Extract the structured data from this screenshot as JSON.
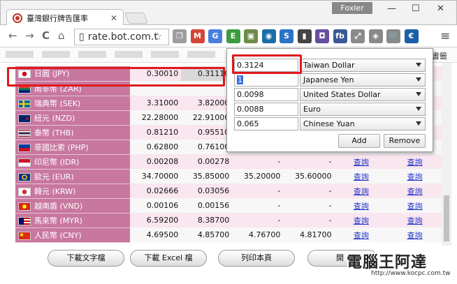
{
  "window": {
    "tab_title": "臺灣銀行牌告匯率",
    "tab_close": "✕",
    "user_label": "Foxler",
    "minimize": "—",
    "maximize": "☐",
    "close": "✕"
  },
  "toolbar": {
    "back": "←",
    "forward": "→",
    "reload": "C",
    "home": "⌂",
    "url": "rate.bot.com.t",
    "star": "☆",
    "menu": "≡",
    "extensions": [
      {
        "name": "copy-extension",
        "label": "❐",
        "color": "#9e9e9e"
      },
      {
        "name": "gmail-extension",
        "label": "M",
        "color": "#d44638"
      },
      {
        "name": "translate-extension",
        "label": "G",
        "color": "#4a7fe0"
      },
      {
        "name": "evernote-extension",
        "label": "E",
        "color": "#3e9c3e"
      },
      {
        "name": "image-extension",
        "label": "▣",
        "color": "#6e8a4a"
      },
      {
        "name": "vpn-extension",
        "label": "◉",
        "color": "#1a6ea8"
      },
      {
        "name": "s-extension",
        "label": "S",
        "color": "#2a73c7"
      },
      {
        "name": "bookmark-extension",
        "label": "▮",
        "color": "#444444"
      },
      {
        "name": "screenshot-extension",
        "label": "◘",
        "color": "#6a4e9e"
      },
      {
        "name": "facebook-extension",
        "label": "fb",
        "color": "#3b5998"
      },
      {
        "name": "share-extension",
        "label": "⤢",
        "color": "#8a8a8a"
      },
      {
        "name": "tag-extension",
        "label": "◈",
        "color": "#8a8a8a"
      },
      {
        "name": "cart-extension",
        "label": "🛒",
        "color": "#8a8a8a"
      },
      {
        "name": "currency-extension",
        "label": "€",
        "color": "#1a5fa8"
      }
    ]
  },
  "bookmarks": {
    "right_label": "書籤"
  },
  "rates": [
    {
      "flag": "jp",
      "currency": "日圓 (JPY)",
      "buy": "0.30010",
      "sell": "0.31110",
      "spot_buy": "",
      "spot_sell": "",
      "q1": "",
      "q2": ""
    },
    {
      "flag": "za",
      "currency": "南非幣 (ZAR)",
      "buy": "",
      "sell": "",
      "spot_buy": "",
      "spot_sell": "",
      "q1": "",
      "q2": ""
    },
    {
      "flag": "se",
      "currency": "瑞典幣 (SEK)",
      "buy": "3.31000",
      "sell": "3.82000",
      "spot_buy": "",
      "spot_sell": "",
      "q1": "",
      "q2": ""
    },
    {
      "flag": "nz",
      "currency": "紐元 (NZD)",
      "buy": "22.28000",
      "sell": "22.91000",
      "spot_buy": "",
      "spot_sell": "",
      "q1": "",
      "q2": ""
    },
    {
      "flag": "th",
      "currency": "泰幣 (THB)",
      "buy": "0.81210",
      "sell": "0.95510",
      "spot_buy": "",
      "spot_sell": "",
      "q1": "",
      "q2": ""
    },
    {
      "flag": "ph",
      "currency": "菲國比索 (PHP)",
      "buy": "0.62800",
      "sell": "0.76100",
      "spot_buy": "",
      "spot_sell": "",
      "q1": "",
      "q2": ""
    },
    {
      "flag": "id",
      "currency": "印尼幣 (IDR)",
      "buy": "0.00208",
      "sell": "0.00278",
      "spot_buy": "-",
      "spot_sell": "-",
      "q1": "查詢",
      "q2": "查詢"
    },
    {
      "flag": "eu",
      "currency": "歐元 (EUR)",
      "buy": "34.70000",
      "sell": "35.85000",
      "spot_buy": "35.20000",
      "spot_sell": "35.60000",
      "q1": "查詢",
      "q2": "查詢"
    },
    {
      "flag": "kr",
      "currency": "韓元 (KRW)",
      "buy": "0.02666",
      "sell": "0.03056",
      "spot_buy": "-",
      "spot_sell": "-",
      "q1": "查詢",
      "q2": "查詢"
    },
    {
      "flag": "vn",
      "currency": "越南盾 (VND)",
      "buy": "0.00106",
      "sell": "0.00156",
      "spot_buy": "-",
      "spot_sell": "-",
      "q1": "查詢",
      "q2": "查詢"
    },
    {
      "flag": "my",
      "currency": "馬來幣 (MYR)",
      "buy": "6.59200",
      "sell": "8.38700",
      "spot_buy": "-",
      "spot_sell": "-",
      "q1": "查詢",
      "q2": "查詢"
    },
    {
      "flag": "cn",
      "currency": "人民幣 (CNY)",
      "buy": "4.69500",
      "sell": "4.85700",
      "spot_buy": "4.76700",
      "spot_sell": "4.81700",
      "q1": "查詢",
      "q2": "查詢"
    }
  ],
  "bottom_buttons": {
    "download_text": "下載文字檔",
    "download_excel": "下載 Excel 檔",
    "print": "列印本頁",
    "partial": "開"
  },
  "converter": {
    "rows": [
      {
        "value": "0.3124",
        "currency": "Taiwan Dollar"
      },
      {
        "value": "1",
        "currency": "Japanese Yen"
      },
      {
        "value": "0.0098",
        "currency": "United States Dollar"
      },
      {
        "value": "0.0088",
        "currency": "Euro"
      },
      {
        "value": "0.065",
        "currency": "Chinese Yuan"
      }
    ],
    "add_label": "Add",
    "remove_label": "Remove"
  },
  "watermark": {
    "title": "電腦王阿達",
    "url": "http://www.kocpc.com.tw"
  },
  "colors": {
    "currency_column": "#c8779f",
    "highlight": "#e0191d",
    "link": "#2233cc"
  }
}
